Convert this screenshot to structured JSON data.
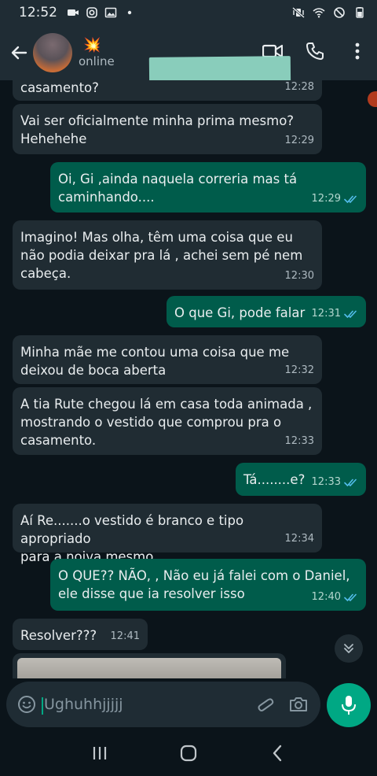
{
  "status_bar": {
    "time": "12:52"
  },
  "header": {
    "contact_emoji": "💥",
    "contact_status": "online"
  },
  "messages": [
    {
      "dir": "in",
      "text": "casamento?",
      "time": "12:28"
    },
    {
      "dir": "in",
      "text": "Vai ser oficialmente minha prima mesmo?\nHehehehe",
      "time": "12:29"
    },
    {
      "dir": "out",
      "text": "Oi, Gi ,ainda naquela correria mas tá\ncaminhando....",
      "time": "12:29"
    },
    {
      "dir": "in",
      "text": "Imagino! Mas olha, têm uma coisa que eu\nnão podia deixar pra lá , achei sem pé nem\ncabeça.",
      "time": "12:30"
    },
    {
      "dir": "out",
      "text": "O que Gi, pode falar",
      "time": "12:31"
    },
    {
      "dir": "in",
      "text": "Minha mãe me contou uma coisa que me\ndeixou de boca aberta",
      "time": "12:32"
    },
    {
      "dir": "in",
      "text": "A tia Rute chegou lá em casa toda animada ,\nmostrando o vestido que comprou pra o\ncasamento.",
      "time": "12:33"
    },
    {
      "dir": "out",
      "text": "Tá........e?",
      "time": "12:33"
    },
    {
      "dir": "in",
      "text": "Aí Re.......o vestido é branco e tipo apropriado\npara a noiva mesmo",
      "time": "12:34"
    },
    {
      "dir": "out",
      "text": "O QUE?? NÃO, , Não eu já falei com o Daniel,\nele disse que ia resolver isso",
      "time": "12:40"
    },
    {
      "dir": "in",
      "text": "Resolver???",
      "time": "12:41"
    }
  ],
  "composer": {
    "draft_text": "Ughuhhjjjjj"
  },
  "colors": {
    "incoming_bubble": "#202c33",
    "outgoing_bubble": "#005c4b",
    "accent": "#00a884",
    "read_tick": "#53bdeb"
  }
}
